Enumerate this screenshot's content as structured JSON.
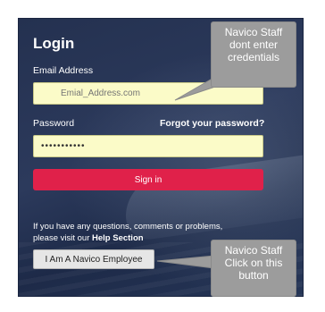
{
  "login": {
    "title": "Login",
    "email_label": "Email Address",
    "email_placeholder": "Emial_Address.com",
    "password_label": "Password",
    "forgot_link": "Forgot your password?",
    "password_value": "•••••••••••",
    "signin_label": "Sign in",
    "help_text_line1": "If you have any questions, comments or problems,",
    "help_text_prefix": "please visit our ",
    "help_link": "Help Section",
    "employee_button": "I Am A Navico Employee"
  },
  "callouts": {
    "first": [
      "Navico Staff",
      "dont enter",
      "credentials"
    ],
    "second": [
      "Navico Staff",
      "Click on this",
      "button"
    ]
  },
  "colors": {
    "panel_bg": "#2c3a5c",
    "input_bg": "#fbfbc8",
    "signin_bg": "#e0214a",
    "callout_bg": "#9c9c9c"
  }
}
